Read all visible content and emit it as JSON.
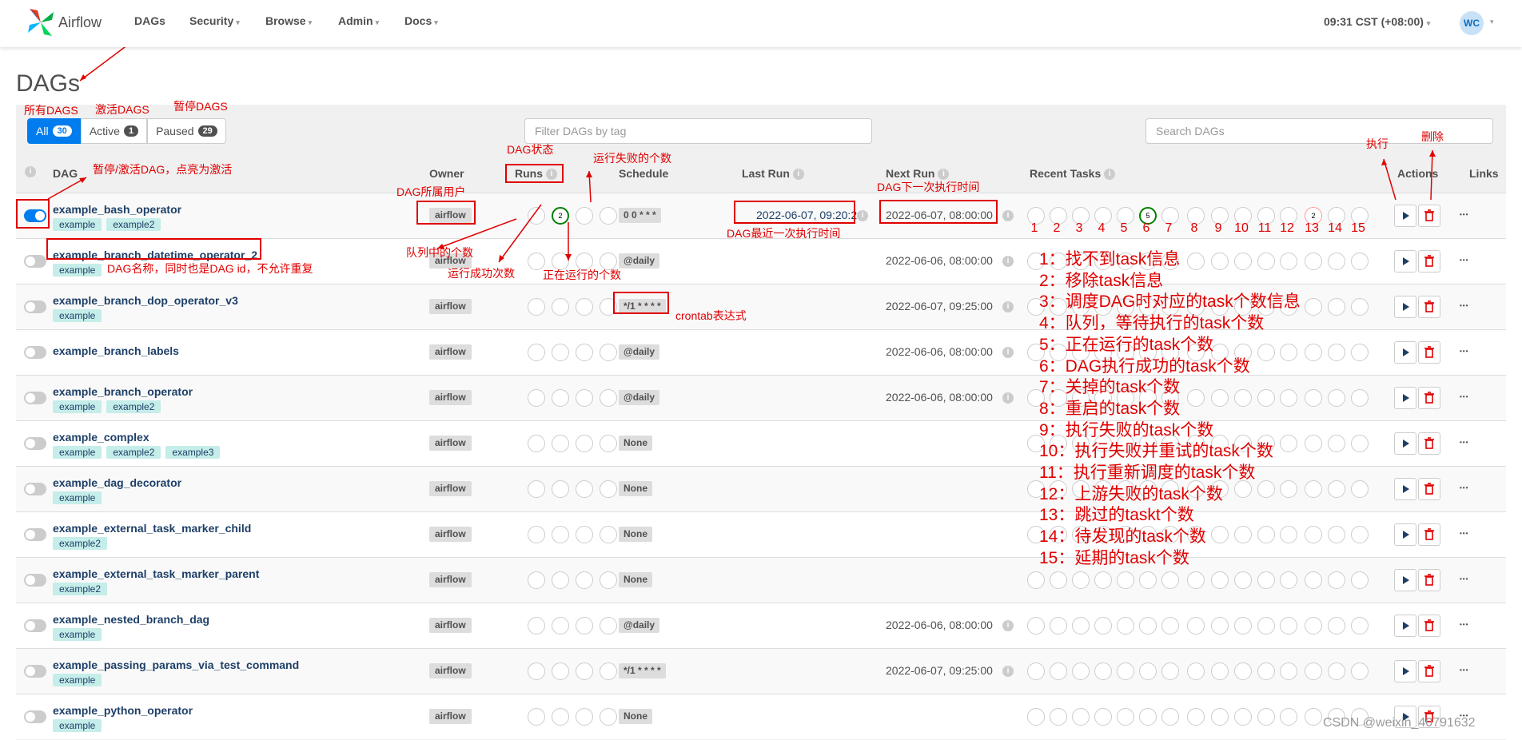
{
  "nav": {
    "brand": "Airflow",
    "items": [
      {
        "label": "DAGs",
        "caret": ""
      },
      {
        "label": "Security",
        "caret": "▾"
      },
      {
        "label": "Browse",
        "caret": "▾"
      },
      {
        "label": "Admin",
        "caret": "▾"
      },
      {
        "label": "Docs",
        "caret": "▾"
      }
    ],
    "time": "09:31 CST (+08:00)",
    "time_caret": "▾",
    "avatar": "WC"
  },
  "page": {
    "title": "DAGs",
    "filters": [
      {
        "label": "All",
        "count": "30"
      },
      {
        "label": "Active",
        "count": "1"
      },
      {
        "label": "Paused",
        "count": "29"
      }
    ],
    "tag_filter_placeholder": "Filter DAGs by tag",
    "search_placeholder": "Search DAGs"
  },
  "headers": {
    "dag": "DAG",
    "owner": "Owner",
    "runs": "Runs",
    "schedule": "Schedule",
    "last_run": "Last Run",
    "next_run": "Next Run",
    "recent_tasks": "Recent Tasks",
    "actions": "Actions",
    "links": "Links"
  },
  "rows": [
    {
      "name": "example_bash_operator",
      "tags": [
        "example",
        "example2"
      ],
      "owner": "airflow",
      "active": true,
      "runs": [
        "",
        "2",
        "",
        ""
      ],
      "schedule": "0 0 * * *",
      "last_run": "2022-06-07, 09:20:28",
      "next_run": "2022-06-07, 08:00:00",
      "tasks": {
        "5": "5",
        "12": "2"
      }
    },
    {
      "name": "example_branch_datetime_operator_2",
      "tags": [
        "example"
      ],
      "owner": "airflow",
      "active": false,
      "runs": [
        "",
        "",
        "",
        ""
      ],
      "schedule": "@daily",
      "last_run": "",
      "next_run": "2022-06-06, 08:00:00",
      "tasks": {}
    },
    {
      "name": "example_branch_dop_operator_v3",
      "tags": [
        "example"
      ],
      "owner": "airflow",
      "active": false,
      "runs": [
        "",
        "",
        "",
        ""
      ],
      "schedule": "*/1 * * * *",
      "last_run": "",
      "next_run": "2022-06-07, 09:25:00",
      "tasks": {}
    },
    {
      "name": "example_branch_labels",
      "tags": [],
      "owner": "airflow",
      "active": false,
      "runs": [
        "",
        "",
        "",
        ""
      ],
      "schedule": "@daily",
      "last_run": "",
      "next_run": "2022-06-06, 08:00:00",
      "tasks": {}
    },
    {
      "name": "example_branch_operator",
      "tags": [
        "example",
        "example2"
      ],
      "owner": "airflow",
      "active": false,
      "runs": [
        "",
        "",
        "",
        ""
      ],
      "schedule": "@daily",
      "last_run": "",
      "next_run": "2022-06-06, 08:00:00",
      "tasks": {}
    },
    {
      "name": "example_complex",
      "tags": [
        "example",
        "example2",
        "example3"
      ],
      "owner": "airflow",
      "active": false,
      "runs": [
        "",
        "",
        "",
        ""
      ],
      "schedule": "None",
      "last_run": "",
      "next_run": "",
      "tasks": {}
    },
    {
      "name": "example_dag_decorator",
      "tags": [
        "example"
      ],
      "owner": "airflow",
      "active": false,
      "runs": [
        "",
        "",
        "",
        ""
      ],
      "schedule": "None",
      "last_run": "",
      "next_run": "",
      "tasks": {}
    },
    {
      "name": "example_external_task_marker_child",
      "tags": [
        "example2"
      ],
      "owner": "airflow",
      "active": false,
      "runs": [
        "",
        "",
        "",
        ""
      ],
      "schedule": "None",
      "last_run": "",
      "next_run": "",
      "tasks": {}
    },
    {
      "name": "example_external_task_marker_parent",
      "tags": [
        "example2"
      ],
      "owner": "airflow",
      "active": false,
      "runs": [
        "",
        "",
        "",
        ""
      ],
      "schedule": "None",
      "last_run": "",
      "next_run": "",
      "tasks": {}
    },
    {
      "name": "example_nested_branch_dag",
      "tags": [
        "example"
      ],
      "owner": "airflow",
      "active": false,
      "runs": [
        "",
        "",
        "",
        ""
      ],
      "schedule": "@daily",
      "last_run": "",
      "next_run": "2022-06-06, 08:00:00",
      "tasks": {}
    },
    {
      "name": "example_passing_params_via_test_command",
      "tags": [
        "example"
      ],
      "owner": "airflow",
      "active": false,
      "runs": [
        "",
        "",
        "",
        ""
      ],
      "schedule": "*/1 * * * *",
      "last_run": "",
      "next_run": "2022-06-07, 09:25:00",
      "tasks": {}
    },
    {
      "name": "example_python_operator",
      "tags": [
        "example"
      ],
      "owner": "airflow",
      "active": false,
      "runs": [
        "",
        "",
        "",
        ""
      ],
      "schedule": "None",
      "last_run": "",
      "next_run": "",
      "tasks": {}
    }
  ],
  "annotations": {
    "all_dags": "所有DAGS",
    "active_dags": "激活DAGS",
    "paused_dags": "暂停DAGS",
    "toggle_hint": "暂停/激活DAG，点亮为激活",
    "dag_state": "DAG状态",
    "failed_runs": "运行失败的个数",
    "owner_hint": "DAG所属用户",
    "next_run_hint": "DAG下一次执行时间",
    "execute": "执行",
    "delete": "删除",
    "queued": "队列中的个数",
    "success_runs": "运行成功次数",
    "running": "正在运行的个数",
    "last_run_hint": "DAG最近一次执行时间",
    "dag_name_hint": "DAG名称，同时也是DAG id，不允许重复",
    "crontab": "crontab表达式",
    "numbers": [
      "1",
      "2",
      "3",
      "4",
      "5",
      "6",
      "7",
      "8",
      "9",
      "10",
      "11",
      "12",
      "13",
      "14",
      "15"
    ],
    "legend": [
      "1：找不到task信息",
      "2：移除task信息",
      "3：调度DAG时对应的task个数信息",
      "4：队列，等待执行的task个数",
      "5：正在运行的task个数",
      "6：DAG执行成功的task个数",
      "7：关掉的task个数",
      "8：重启的task个数",
      "9：执行失败的task个数",
      "10：执行失败并重试的task个数",
      "11：执行重新调度的task个数",
      "12：上游失败的task个数",
      "13：跳过的taskt个数",
      "14：待发现的task个数",
      "15：延期的task个数"
    ]
  },
  "watermark": "CSDN @weixin_40791632",
  "colors": {
    "accent": "#017cee",
    "annotation": "#e00000",
    "success": "#008000",
    "tag": "#c5ede9"
  }
}
